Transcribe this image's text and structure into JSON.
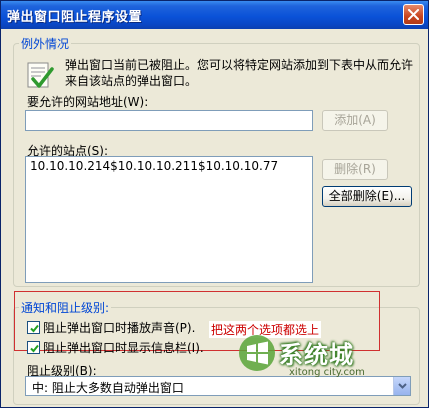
{
  "window": {
    "title": "弹出窗口阻止程序设置"
  },
  "exceptions": {
    "legend": "例外情况",
    "intro": "弹出窗口当前已被阻止。您可以将特定网站添加到下表中从而允许来自该站点的弹出窗口。",
    "address_label": "要允许的网站地址(W):",
    "address_value": "",
    "add_button": "添加(A)",
    "allowed_label": "允许的站点(S):",
    "allowed_sites": [
      "10.10.10.214$10.10.10.211$10.10.10.77"
    ],
    "remove_button": "删除(R)",
    "remove_all_button": "全部删除(E)..."
  },
  "notifications": {
    "legend": "通知和阻止级别:",
    "play_sound_label": "阻止弹出窗口时播放声音(P).",
    "play_sound_checked": true,
    "show_bar_label": "阻止弹出窗口时显示信息栏(I).",
    "show_bar_checked": true,
    "annotation": "把这两个选项都选上",
    "level_label": "阻止级别(B):",
    "level_value": "中: 阻止大多数自动弹出窗口"
  },
  "watermark": {
    "name": "系统城",
    "url": "xitong city.com"
  },
  "icons": {
    "close": "close-icon",
    "info": "info-check-icon",
    "dropdown": "chevron-down-icon",
    "watermark_logo": "windows-flag-icon"
  },
  "colors": {
    "titlebar": "#0a52d8",
    "legend_text": "#0046d5",
    "annotation": "#cc0000",
    "highlight_box": "#d03030"
  }
}
